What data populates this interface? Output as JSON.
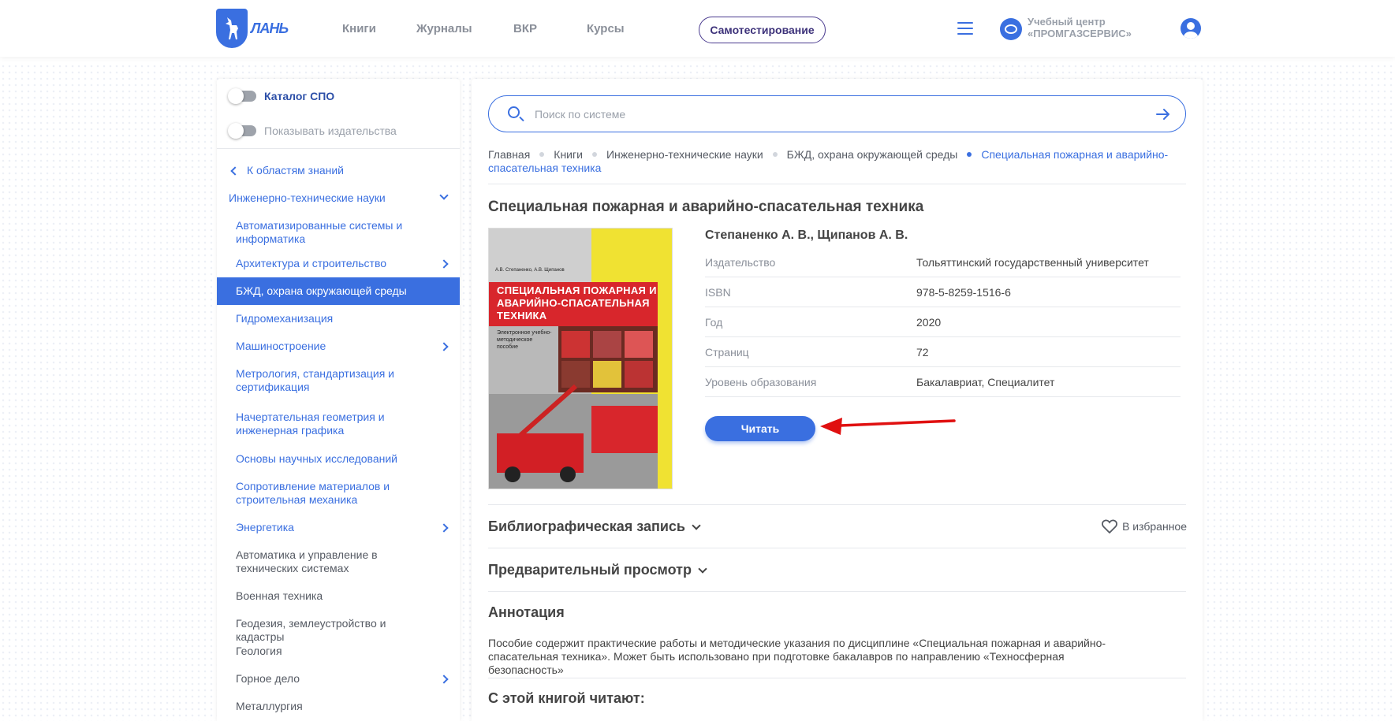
{
  "header": {
    "logo_text": "ЛАНЬ",
    "nav": [
      "Книги",
      "Журналы",
      "ВКР",
      "Курсы"
    ],
    "self_test": "Самотестирование",
    "org_line1": "Учебный центр",
    "org_line2": "«ПРОМГАЗСЕРВИС»"
  },
  "sidebar": {
    "toggle_spo": "Каталог СПО",
    "toggle_publishers": "Показывать издательства",
    "back_link": "К областям знаний",
    "parent": "Инженерно-технические науки",
    "items": [
      {
        "label": "Автоматизированные системы и информатика"
      },
      {
        "label": "Архитектура и строительство"
      },
      {
        "label": "БЖД, охрана окружающей среды"
      },
      {
        "label": "Гидромеханизация"
      },
      {
        "label": "Машиностроение"
      },
      {
        "label": "Метрология, стандартизация и сертификация"
      },
      {
        "label": "Начертательная геометрия и инженерная графика"
      },
      {
        "label": "Основы научных исследований"
      },
      {
        "label": "Сопротивление материалов и строительная механика"
      },
      {
        "label": "Энергетика"
      },
      {
        "label": "Автоматика и управление в технических системах"
      },
      {
        "label": "Военная техника"
      },
      {
        "label": "Геодезия, землеустройство и кадастры"
      },
      {
        "label": "Геология"
      },
      {
        "label": "Горное дело"
      },
      {
        "label": "Металлургия"
      }
    ]
  },
  "search": {
    "placeholder": "Поиск по системе"
  },
  "breadcrumb": {
    "items": [
      "Главная",
      "Книги",
      "Инженерно-технические науки",
      "БЖД, охрана окружающей среды"
    ],
    "current": "Специальная пожарная и аварийно-спасательная техника"
  },
  "book": {
    "title": "Специальная пожарная и аварийно-спасательная техника",
    "authors": "Степаненко А. В., Щипанов А. В.",
    "meta": [
      {
        "key": "Издательство",
        "value": "Тольяттинский государственный университет"
      },
      {
        "key": "ISBN",
        "value": "978-5-8259-1516-6"
      },
      {
        "key": "Год",
        "value": "2020"
      },
      {
        "key": "Страниц",
        "value": "72"
      },
      {
        "key": "Уровень образования",
        "value": "Бакалавриат, Специалитет"
      }
    ],
    "read_button": "Читать",
    "cover": {
      "authors": "А.В. Степаненко, А.В. Щипанов",
      "title": "СПЕЦИАЛЬНАЯ ПОЖАРНАЯ И АВАРИЙНО-СПАСАТЕЛЬНАЯ ТЕХНИКА",
      "subtitle": "Электронное учебно-методическое пособие"
    }
  },
  "sections": {
    "bibliographic": "Библиографическая запись",
    "favorite": "В избранное",
    "preview": "Предварительный просмотр",
    "annotation_title": "Аннотация",
    "annotation_text": "Пособие содержит практические работы и методические указания по дисциплине «Специальная пожарная и аварийно-спасательная техника». Может быть использовано при подготовке бакалавров по направлению «Техносферная безопасность»",
    "also_read": "С этой книгой читают:"
  },
  "colors": {
    "accent": "#3a6fe0",
    "arrow": "#e01010"
  }
}
